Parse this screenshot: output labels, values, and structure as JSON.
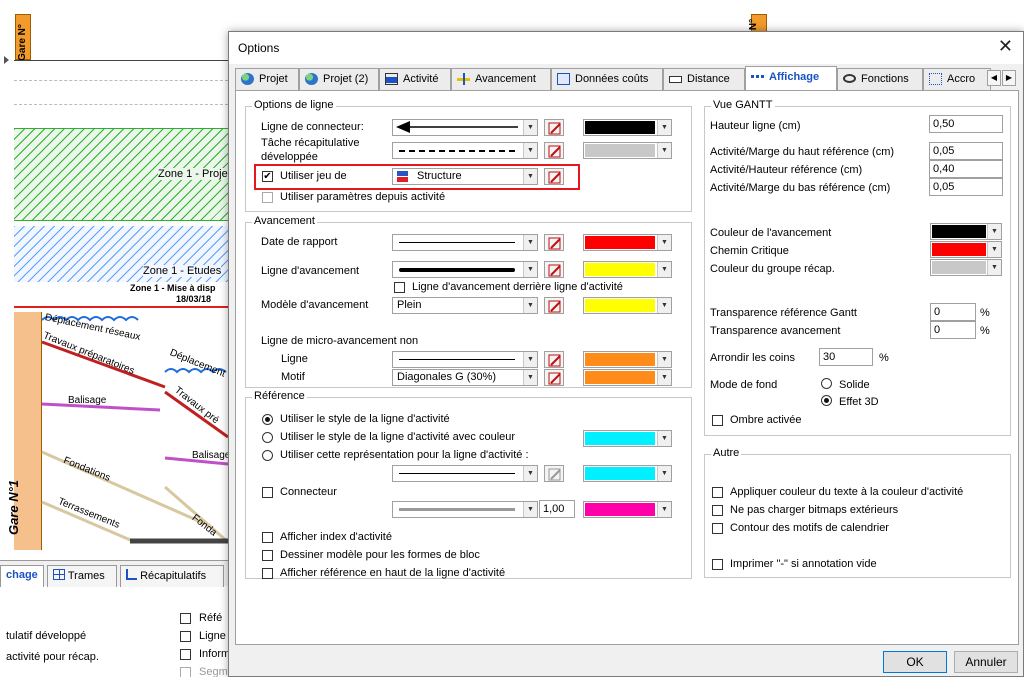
{
  "background": {
    "gare_top_left": "Gare N°",
    "gare_top_right": "N°",
    "gare_side": "Gare N°1",
    "zone1_label": "Zone 1 - Proje",
    "zone1_etudes_label": "Zone 1 - Etudes",
    "zone1_mise_label": "Zone 1 - Mise à disp",
    "zone1_mise_date": "18/03/18",
    "activities": [
      "Déplacement réseaux",
      "Travaux préparatoires",
      "Déplacement",
      "Balisage",
      "Travaux pré",
      "Balisage",
      "Fondations",
      "Terrassements",
      "Fonda"
    ],
    "bottom_tabs": [
      "chage",
      "Trames",
      "Récapitulatifs"
    ],
    "left_text": [
      "tulatif développé",
      "activité pour récap."
    ],
    "right_check_labels": [
      "Réfé",
      "Ligne",
      "Inform",
      "Segme"
    ]
  },
  "dialog": {
    "title": "Options",
    "tabs": [
      "Projet",
      "Projet (2)",
      "Activité",
      "Avancement",
      "Données coûts",
      "Distance",
      "Affichage",
      "Fonctions",
      "Accro"
    ],
    "active_tab": "Affichage",
    "options_ligne": {
      "title": "Options de ligne",
      "connecteur_label": "Ligne de connecteur:",
      "tache_label_1": "Tâche récapitulative",
      "tache_label_2": "développée",
      "jeu_label": "Utiliser jeu de",
      "jeu_value": "Structure",
      "jeu_checked": true,
      "params_label": "Utiliser paramètres depuis activité"
    },
    "avancement": {
      "title": "Avancement",
      "date_rapport_label": "Date de rapport",
      "ligne_avancement_label": "Ligne d'avancement",
      "derriere_label": "Ligne d'avancement derrière ligne d'activité",
      "modele_label": "Modèle d'avancement",
      "modele_value": "Plein",
      "micro_label": "Ligne de micro-avancement non",
      "ligne_label": "Ligne",
      "motif_label": "Motif",
      "motif_value": "Diagonales G (30%)"
    },
    "reference": {
      "title": "Référence",
      "opt1": "Utiliser le style de la ligne d'activité",
      "opt2": "Utiliser le style de la ligne d'activité avec couleur",
      "opt3": "Utiliser cette représentation pour la ligne d'activité :",
      "connecteur_label": "Connecteur",
      "connecteur_value": "1,00",
      "index_label": "Afficher index d'activité",
      "dessiner_label": "Dessiner modèle pour les formes de bloc",
      "haut_label": "Afficher référence en haut de la ligne d'activité"
    },
    "vue_gantt": {
      "title": "Vue GANTT",
      "hauteur_ligne_label": "Hauteur ligne (cm)",
      "hauteur_ligne_value": "0,50",
      "marge_haut_label": "Activité/Marge du haut référence (cm)",
      "marge_haut_value": "0,05",
      "hauteur_ref_label": "Activité/Hauteur référence (cm)",
      "hauteur_ref_value": "0,40",
      "marge_bas_label": "Activité/Marge du bas référence (cm)",
      "marge_bas_value": "0,05",
      "couleur_avancement_label": "Couleur de l'avancement",
      "chemin_critique_label": "Chemin Critique",
      "couleur_groupe_label": "Couleur du groupe récap.",
      "transp_ref_label": "Transparence référence Gantt",
      "transp_ref_value": "0",
      "transp_av_label": "Transparence avancement",
      "transp_av_value": "0",
      "percent": "%",
      "arrondir_label": "Arrondir les coins",
      "arrondir_value": "30",
      "mode_fond_label": "Mode de fond",
      "solide_label": "Solide",
      "effet3d_label": "Effet 3D",
      "ombre_label": "Ombre activée"
    },
    "autre": {
      "title": "Autre",
      "opt1": "Appliquer couleur du texte à la couleur d'activité",
      "opt2": "Ne pas charger bitmaps extérieurs",
      "opt3": "Contour des motifs de calendrier",
      "opt4": "Imprimer \"-\" si annotation vide"
    },
    "ok_label": "OK",
    "cancel_label": "Annuler"
  },
  "colors": {
    "black": "#000000",
    "grey": "#c8c8c8",
    "red": "#ff0000",
    "yellow": "#ffff00",
    "orange": "#ff8c1a",
    "cyan": "#00f0ff",
    "magenta": "#ff00a8",
    "highlight": "#e8161b",
    "accent_tab": "#1b53c5"
  }
}
